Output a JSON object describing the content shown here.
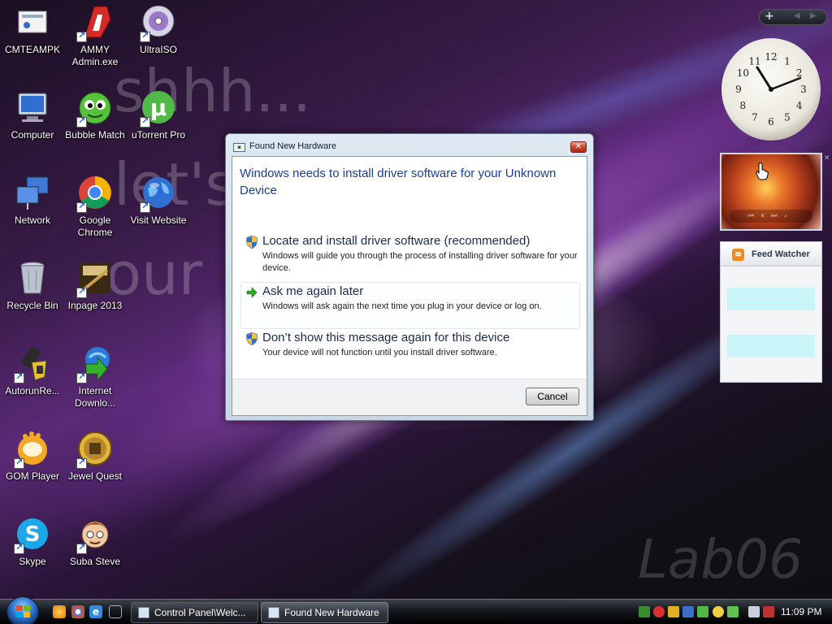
{
  "wallpaper": {
    "line1": "shhh...",
    "line2": "let's",
    "line3": "our h",
    "watermark": "Lab06"
  },
  "desktop_icons": [
    {
      "label": "CMTEAMPK",
      "icon": "user-folder-icon"
    },
    {
      "label": "AMMY Admin.exe",
      "icon": "ammy-admin-icon"
    },
    {
      "label": "UltraISO",
      "icon": "disc-icon"
    },
    {
      "label": "Computer",
      "icon": "computer-icon"
    },
    {
      "label": "Bubble Match",
      "icon": "bubble-match-icon"
    },
    {
      "label": "uTorrent Pro",
      "icon": "utorrent-icon"
    },
    {
      "label": "Network",
      "icon": "network-icon"
    },
    {
      "label": "Google Chrome",
      "icon": "chrome-icon"
    },
    {
      "label": "Visit Website",
      "icon": "globe-icon"
    },
    {
      "label": "Recycle Bin",
      "icon": "recycle-bin-icon"
    },
    {
      "label": "Inpage 2013",
      "icon": "inpage-icon"
    },
    {
      "label": "AutorunRe...",
      "icon": "autorun-icon"
    },
    {
      "label": "Internet Downlo...",
      "icon": "internet-download-icon"
    },
    {
      "label": "GOM Player",
      "icon": "gom-player-icon"
    },
    {
      "label": "Jewel Quest",
      "icon": "jewel-quest-icon"
    },
    {
      "label": "Skype",
      "icon": "skype-icon"
    },
    {
      "label": "Suba Steve",
      "icon": "suba-steve-icon"
    }
  ],
  "gadgets": {
    "feed_watcher_title": "Feed Watcher",
    "clock_numbers": [
      "12",
      "1",
      "2",
      "3",
      "4",
      "5",
      "6",
      "7",
      "8",
      "9",
      "10",
      "11"
    ]
  },
  "dialog": {
    "title": "Found New Hardware",
    "heading": "Windows needs to install driver software for your Unknown Device",
    "options": [
      {
        "title": "Locate and install driver software (recommended)",
        "description": "Windows will guide you through the process of installing driver software for your device.",
        "icon": "shield-icon"
      },
      {
        "title": "Ask me again later",
        "description": "Windows will ask again the next time you plug in your device or log on.",
        "icon": "green-arrow-icon"
      },
      {
        "title": "Don’t show this message again for this device",
        "description": "Your device will not function until you install driver software.",
        "icon": "shield-icon"
      }
    ],
    "cancel_label": "Cancel"
  },
  "taskbar": {
    "buttons": [
      {
        "label": "Control Panel\\Welc..."
      },
      {
        "label": "Found New Hardware"
      }
    ],
    "time": "11:09 PM"
  }
}
